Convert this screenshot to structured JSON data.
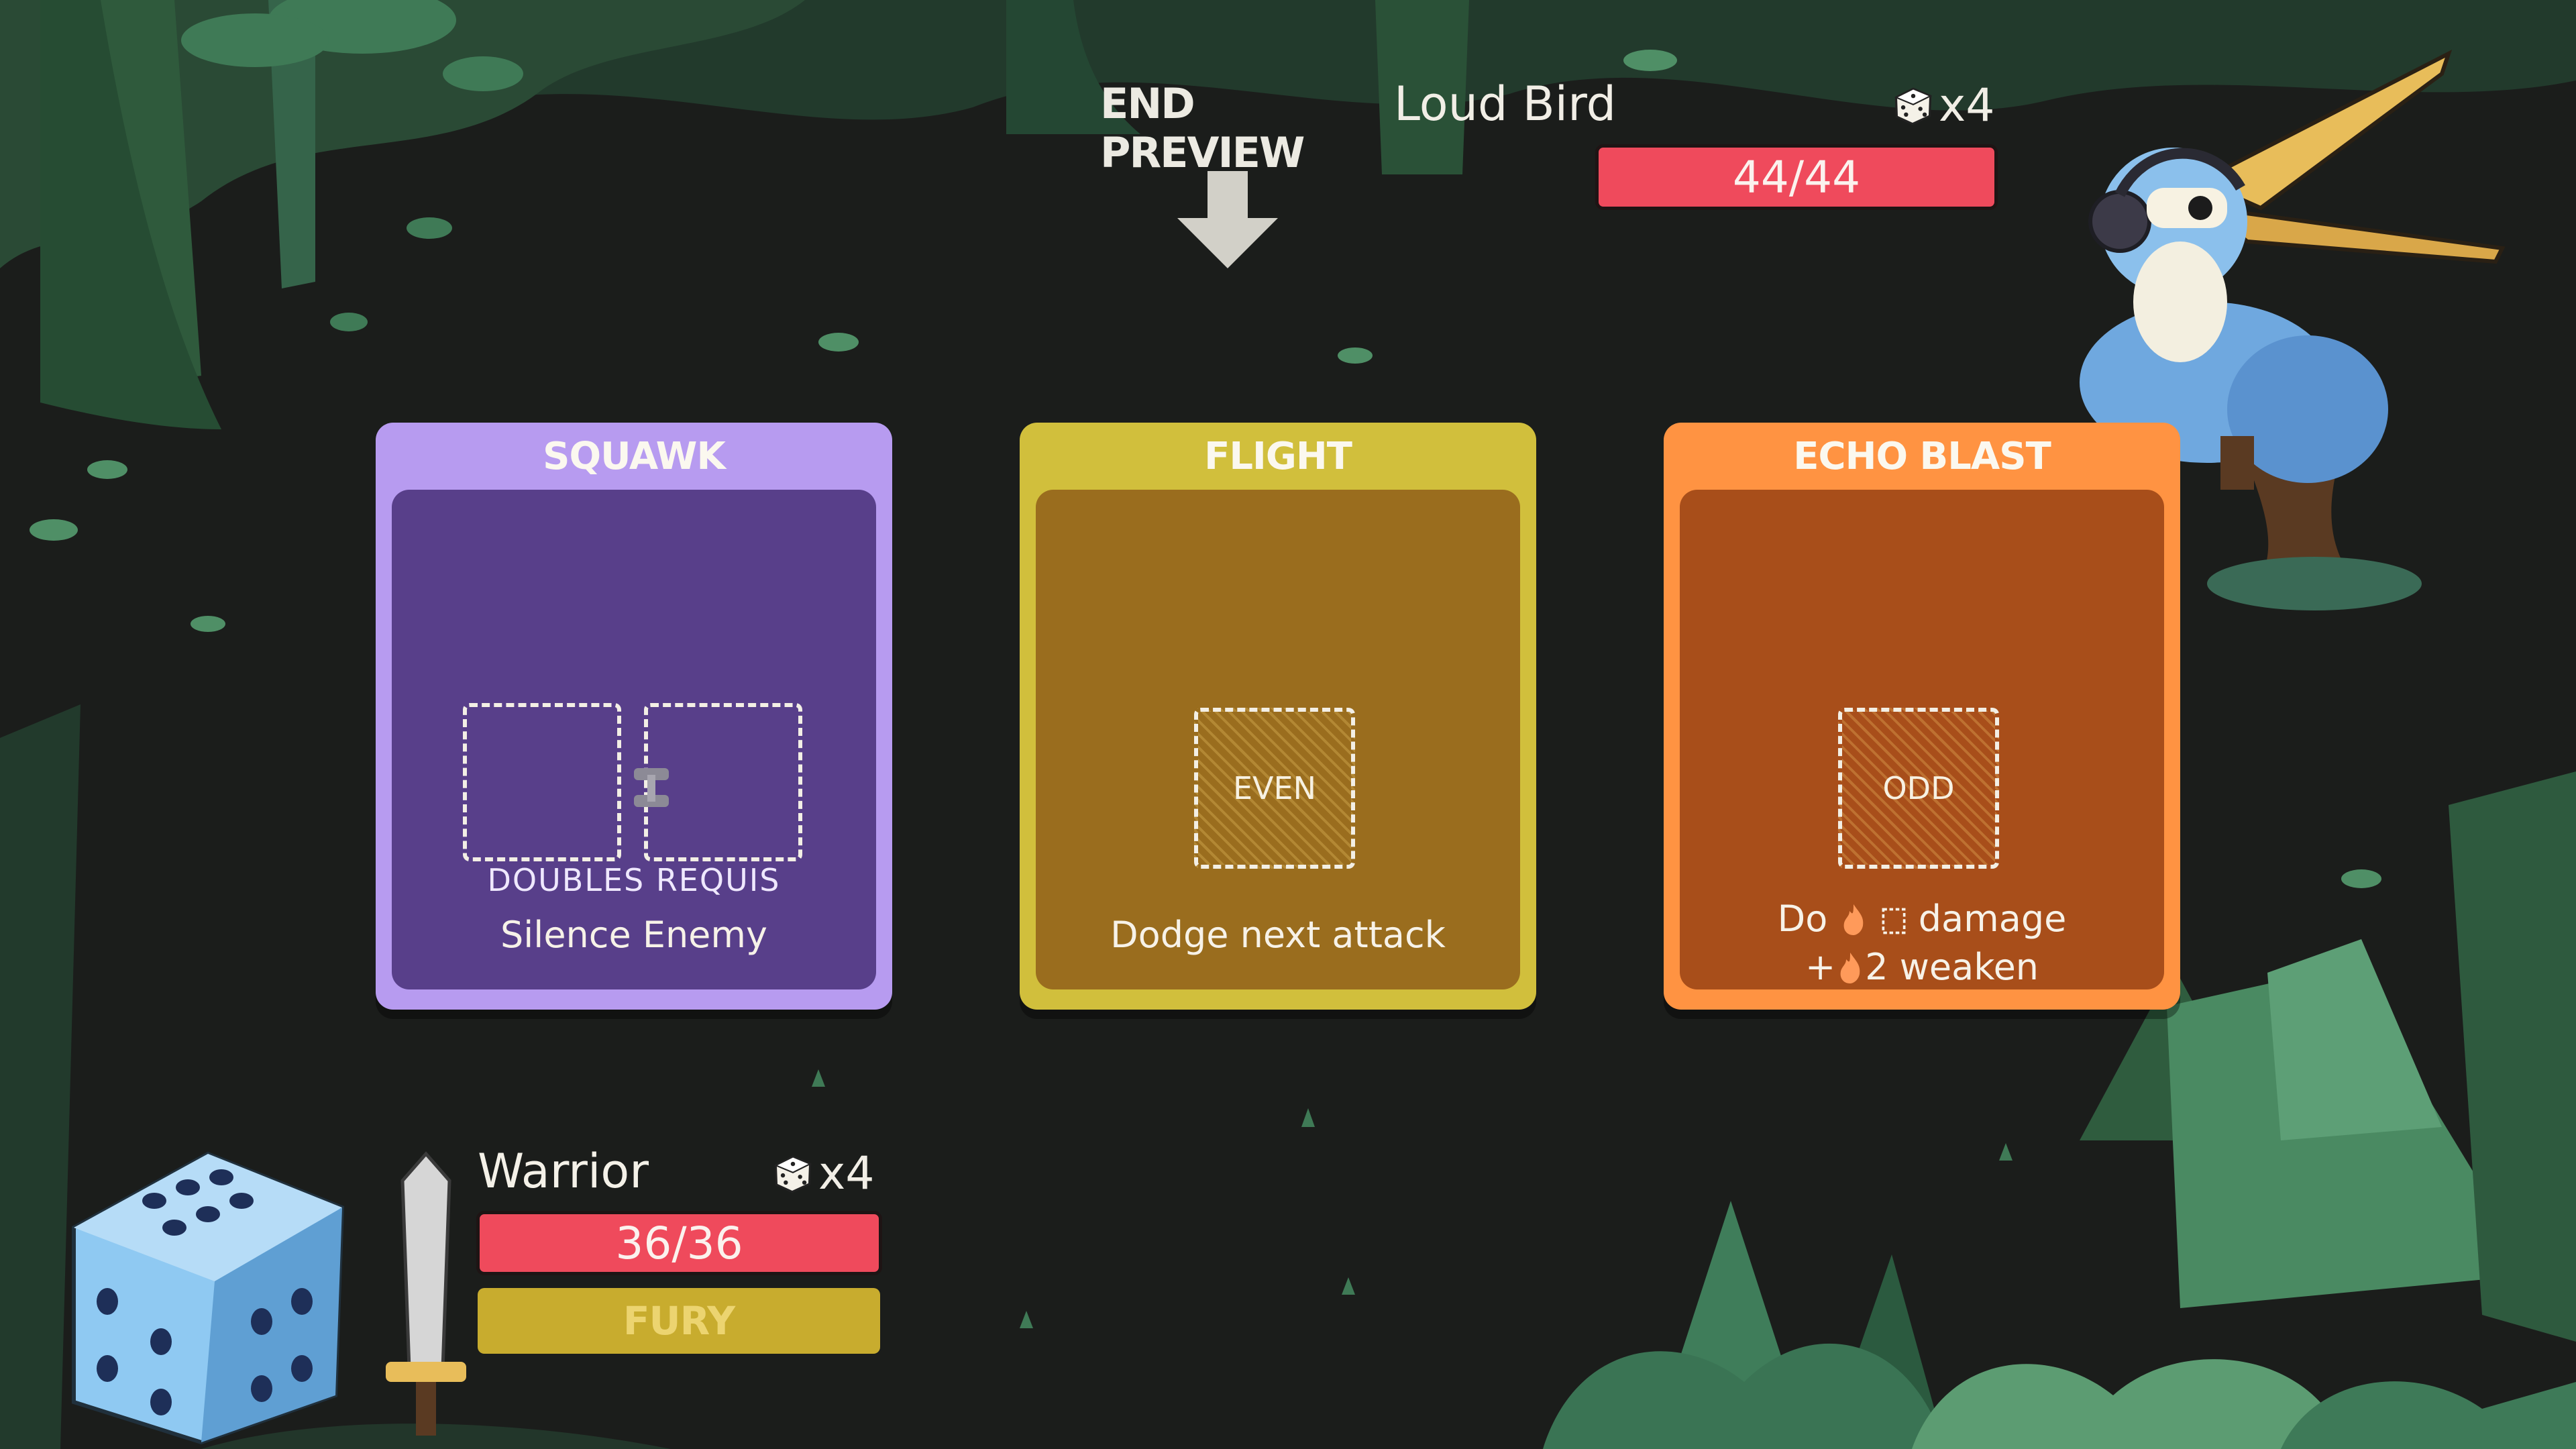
{
  "top": {
    "end_preview_label": "END PREVIEW",
    "enemy_name": "Loud Bird",
    "enemy_dice_count": "x4",
    "enemy_hp": "44/44"
  },
  "cards": [
    {
      "title": "SQUAWK",
      "slot_requirement": "DOUBLES REQUIS",
      "description": "Silence Enemy"
    },
    {
      "title": "FLIGHT",
      "slot_label": "EVEN",
      "description": "Dodge next attack"
    },
    {
      "title": "ECHO BLAST",
      "slot_label": "ODD",
      "description_line1_prefix": "Do",
      "description_line1_suffix": "damage",
      "description_line2_prefix": "+",
      "description_line2_suffix": "2 weaken"
    }
  ],
  "player": {
    "name": "Warrior",
    "dice_count": "x4",
    "hp": "36/36",
    "limit_break": "FURY"
  },
  "icons": {
    "dice": "dice-icon",
    "arrow": "down-arrow-icon",
    "weaken": "flame-icon",
    "link": "link-icon"
  },
  "colors": {
    "hp": "#ef4a5c",
    "squawk": "#b79bf0",
    "flight": "#d1bf3c",
    "echo_blast": "#ff9342",
    "fury": "#c8ac2e"
  }
}
